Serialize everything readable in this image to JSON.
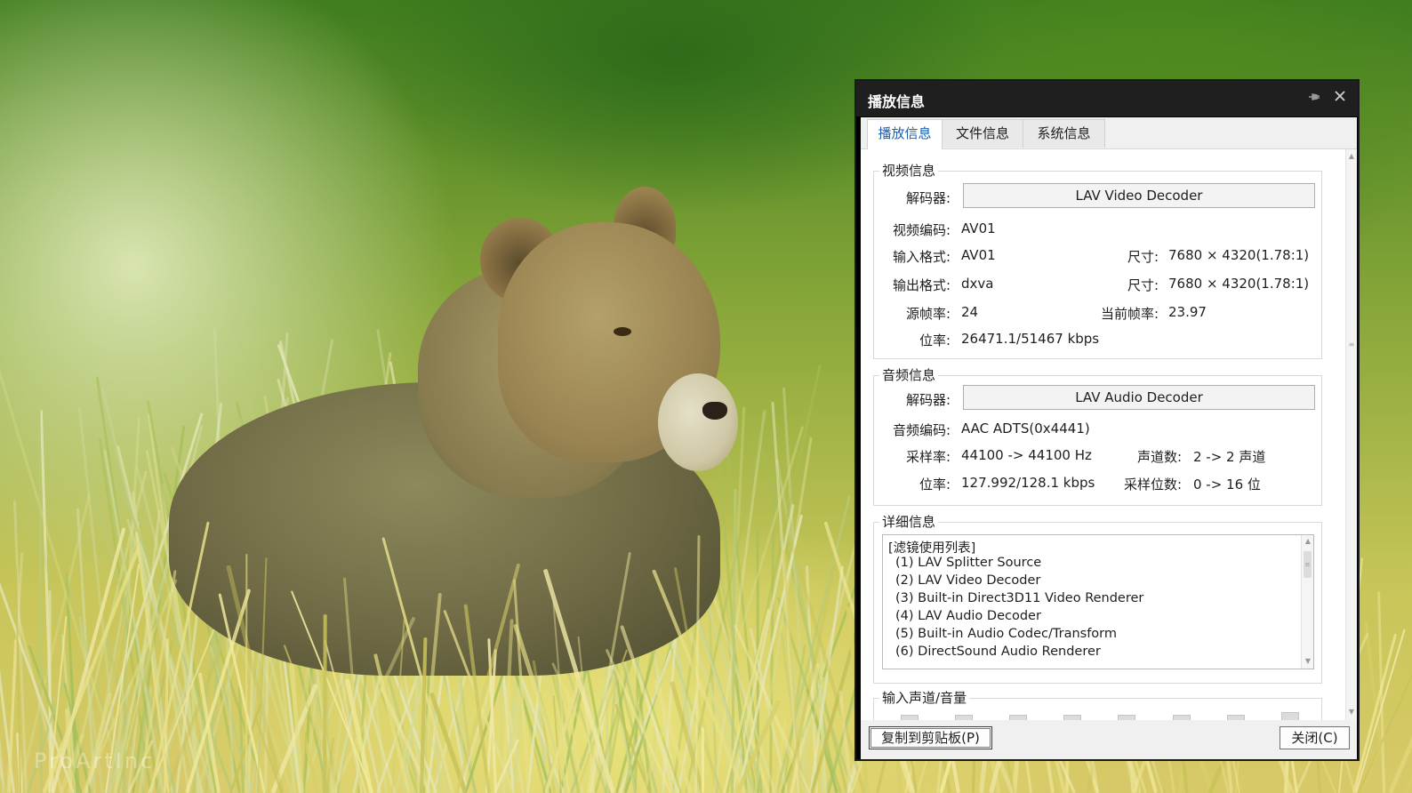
{
  "background": {
    "watermark": "ProArtInc"
  },
  "dialog": {
    "title": "播放信息",
    "pin_icon": "pin-icon",
    "close_icon": "close-icon",
    "tabs": [
      {
        "label": "播放信息",
        "active": true
      },
      {
        "label": "文件信息",
        "active": false
      },
      {
        "label": "系统信息",
        "active": false
      }
    ],
    "video": {
      "section_title": "视频信息",
      "decoder_label": "解码器:",
      "decoder_value": "LAV Video Decoder",
      "codec_label": "视频编码:",
      "codec_value": "AV01",
      "input_format_label": "输入格式:",
      "input_format_value": "AV01",
      "input_size_label": "尺寸:",
      "input_size_value": "7680 × 4320(1.78:1)",
      "output_format_label": "输出格式:",
      "output_format_value": "dxva",
      "output_size_label": "尺寸:",
      "output_size_value": "7680 × 4320(1.78:1)",
      "source_fps_label": "源帧率:",
      "source_fps_value": "24",
      "current_fps_label": "当前帧率:",
      "current_fps_value": "23.97",
      "bitrate_label": "位率:",
      "bitrate_value": "26471.1/51467 kbps"
    },
    "audio": {
      "section_title": "音频信息",
      "decoder_label": "解码器:",
      "decoder_value": "LAV Audio Decoder",
      "codec_label": "音频编码:",
      "codec_value": "AAC ADTS(0x4441)",
      "sample_rate_label": "采样率:",
      "sample_rate_value": "44100 -> 44100 Hz",
      "channels_label": "声道数:",
      "channels_value": "2 -> 2 声道",
      "bitrate_label": "位率:",
      "bitrate_value": "127.992/128.1 kbps",
      "bits_label": "采样位数:",
      "bits_value": "0 -> 16 位"
    },
    "details": {
      "section_title": "详细信息",
      "lines": [
        "[滤镜使用列表]",
        "  (1) LAV Splitter Source",
        "  (2) LAV Video Decoder",
        "  (3) Built-in Direct3D11 Video Renderer",
        "  (4) LAV Audio Decoder",
        "  (5) Built-in Audio Codec/Transform",
        "  (6) DirectSound Audio Renderer"
      ]
    },
    "input_channels": {
      "section_title": "输入声道/音量"
    },
    "footer": {
      "copy_button": "复制到剪贴板(P)",
      "close_button": "关闭(C)"
    }
  }
}
